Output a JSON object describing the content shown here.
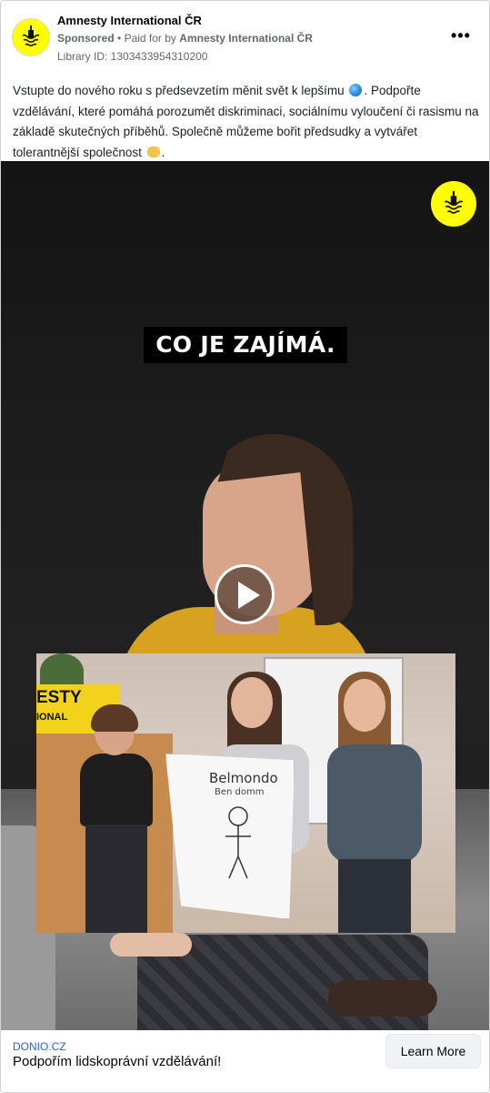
{
  "header": {
    "page_name": "Amnesty International ČR",
    "sponsored": "Sponsored",
    "separator": "•",
    "paid_for_prefix": "Paid for by",
    "paid_for_by": "Amnesty International ČR",
    "library_id": "Library ID: 1303433954310200",
    "more_label": "•••"
  },
  "post": {
    "text_part1": "Vstupte do nového roku s předsevzetím měnit svět k lepšímu",
    "text_part2": ". Podpořte vzdělávání, které pomáhá porozumět diskriminaci, sociálnímu vyloučení či rasismu na základě skutečných příběhů. Společně můžeme bořit předsudky a vytvářet tolerantnější společnost",
    "text_part3": ".",
    "emoji_1": "globe-emoji",
    "emoji_2": "handshake-emoji"
  },
  "video": {
    "caption": "CO JE ZAJÍMÁ.",
    "poster_title": "Belmondo",
    "poster_subtitle": "Ben domm",
    "banner_line1": "ESTY",
    "banner_line2": "IONAL"
  },
  "footer": {
    "domain": "DONIO.CZ",
    "headline": "Podpořím lidskoprávní vzdělávání!",
    "cta_label": "Learn More"
  },
  "colors": {
    "brand_yellow": "#ffff00",
    "link_blue": "#1b6ac9",
    "meta_gray": "#65676b"
  }
}
